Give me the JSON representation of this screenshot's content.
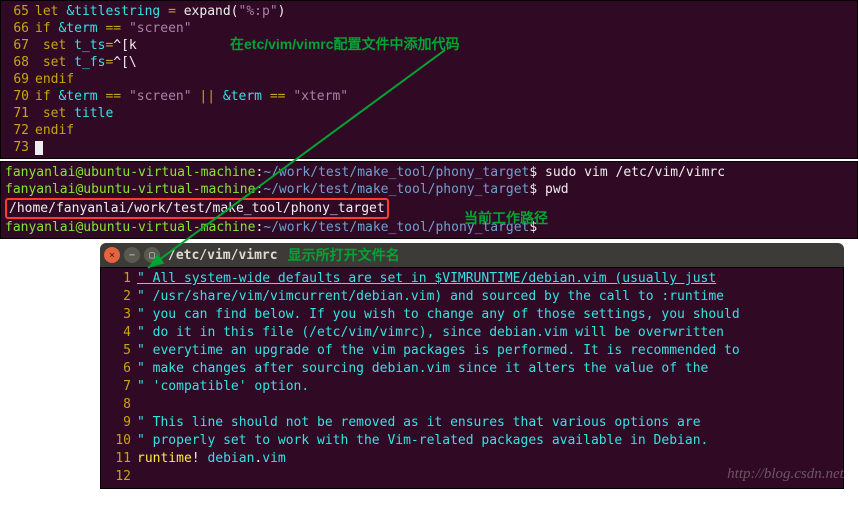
{
  "top_editor": {
    "lines": [
      {
        "n": "65",
        "tokens": [
          {
            "c": "kw",
            "t": "let"
          },
          {
            "c": "txt",
            "t": " "
          },
          {
            "c": "id",
            "t": "&titlestring"
          },
          {
            "c": "txt",
            "t": " "
          },
          {
            "c": "op",
            "t": "="
          },
          {
            "c": "txt",
            "t": " expand("
          },
          {
            "c": "str",
            "t": "\"%:p\""
          },
          {
            "c": "txt",
            "t": ")"
          }
        ]
      },
      {
        "n": "66",
        "tokens": [
          {
            "c": "kw",
            "t": "if"
          },
          {
            "c": "txt",
            "t": " "
          },
          {
            "c": "id",
            "t": "&term"
          },
          {
            "c": "txt",
            "t": " "
          },
          {
            "c": "op",
            "t": "=="
          },
          {
            "c": "txt",
            "t": " "
          },
          {
            "c": "str",
            "t": "\"screen\""
          }
        ]
      },
      {
        "n": "67",
        "tokens": [
          {
            "c": "txt",
            "t": "  "
          },
          {
            "c": "kw",
            "t": "set"
          },
          {
            "c": "txt",
            "t": " "
          },
          {
            "c": "id",
            "t": "t_ts"
          },
          {
            "c": "op",
            "t": "="
          },
          {
            "c": "txt",
            "t": "^[k"
          }
        ]
      },
      {
        "n": "68",
        "tokens": [
          {
            "c": "txt",
            "t": "  "
          },
          {
            "c": "kw",
            "t": "set"
          },
          {
            "c": "txt",
            "t": " "
          },
          {
            "c": "id",
            "t": "t_fs"
          },
          {
            "c": "op",
            "t": "="
          },
          {
            "c": "txt",
            "t": "^[\\"
          }
        ]
      },
      {
        "n": "69",
        "tokens": [
          {
            "c": "kw",
            "t": "endif"
          }
        ]
      },
      {
        "n": "70",
        "tokens": [
          {
            "c": "kw",
            "t": "if"
          },
          {
            "c": "txt",
            "t": " "
          },
          {
            "c": "id",
            "t": "&term"
          },
          {
            "c": "txt",
            "t": " "
          },
          {
            "c": "op",
            "t": "=="
          },
          {
            "c": "txt",
            "t": " "
          },
          {
            "c": "str",
            "t": "\"screen\""
          },
          {
            "c": "txt",
            "t": " "
          },
          {
            "c": "op",
            "t": "||"
          },
          {
            "c": "txt",
            "t": " "
          },
          {
            "c": "id",
            "t": "&term"
          },
          {
            "c": "txt",
            "t": " "
          },
          {
            "c": "op",
            "t": "=="
          },
          {
            "c": "txt",
            "t": " "
          },
          {
            "c": "str",
            "t": "\"xterm\""
          }
        ]
      },
      {
        "n": "71",
        "tokens": [
          {
            "c": "txt",
            "t": "  "
          },
          {
            "c": "kw",
            "t": "set"
          },
          {
            "c": "txt",
            "t": " "
          },
          {
            "c": "id",
            "t": "title"
          }
        ]
      },
      {
        "n": "72",
        "tokens": [
          {
            "c": "kw",
            "t": "endif"
          }
        ]
      },
      {
        "n": "73",
        "tokens": []
      }
    ]
  },
  "annotations": {
    "top_note": "在etc/vim/vimrc配置文件中添加代码",
    "cwd_note": "当前工作路径",
    "title_note": "显示所打开文件名"
  },
  "terminal": {
    "user": "fanyanlai",
    "host": "ubuntu-virtual-machine",
    "cwd": "~/work/test/make_tool/phony_target",
    "lines": [
      {
        "cmd": "sudo vim /etc/vim/vimrc"
      },
      {
        "cmd": "pwd"
      },
      {
        "out": "/home/fanyanlai/work/test/make_tool/phony_target",
        "boxed": true
      },
      {
        "cmd": ""
      }
    ]
  },
  "window": {
    "title": "/etc/vim/vimrc"
  },
  "bottom_editor": {
    "lines": [
      {
        "n": "1",
        "u": true,
        "tokens": [
          {
            "c": "cmt",
            "t": "\" All system-wide defaults are set in $VIMRUNTIME/debian.vim (usually just"
          }
        ]
      },
      {
        "n": "2",
        "tokens": [
          {
            "c": "cmt",
            "t": "\" /usr/share/vim/vimcurrent/debian.vim) and sourced by the call to :runtime"
          }
        ]
      },
      {
        "n": "3",
        "tokens": [
          {
            "c": "cmt",
            "t": "\" you can find below.  If you wish to change any of those settings, you should"
          }
        ]
      },
      {
        "n": "4",
        "tokens": [
          {
            "c": "cmt",
            "t": "\" do it in this file (/etc/vim/vimrc), since debian.vim will be overwritten"
          }
        ]
      },
      {
        "n": "5",
        "tokens": [
          {
            "c": "cmt",
            "t": "\" everytime an upgrade of the vim packages is performed.  It is recommended to"
          }
        ]
      },
      {
        "n": "6",
        "tokens": [
          {
            "c": "cmt",
            "t": "\" make changes after sourcing debian.vim since it alters the value of the"
          }
        ]
      },
      {
        "n": "7",
        "tokens": [
          {
            "c": "cmt",
            "t": "\" 'compatible' option."
          }
        ]
      },
      {
        "n": "8",
        "tokens": []
      },
      {
        "n": "9",
        "tokens": [
          {
            "c": "cmt",
            "t": "\" This line should not be removed as it ensures that various options are"
          }
        ]
      },
      {
        "n": "10",
        "tokens": [
          {
            "c": "cmt",
            "t": "\" properly set to work with the Vim-related packages available in Debian."
          }
        ]
      },
      {
        "n": "11",
        "tokens": [
          {
            "c": "runtime",
            "t": "runtime"
          },
          {
            "c": "txt",
            "t": "! "
          },
          {
            "c": "debian",
            "t": "debian"
          },
          {
            "c": "txt",
            "t": "."
          },
          {
            "c": "vimext",
            "t": "vim"
          }
        ]
      },
      {
        "n": "12",
        "tokens": []
      }
    ]
  },
  "watermark": "http://blog.csdn.net/"
}
